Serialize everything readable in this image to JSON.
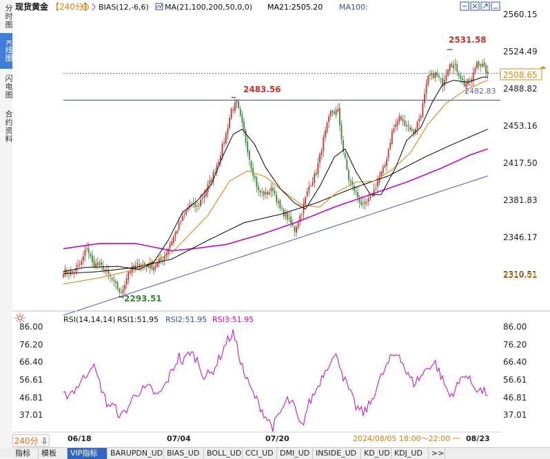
{
  "left_tabs": [
    "分时图",
    "K线图",
    "闪电图",
    "合约资料"
  ],
  "active_left_tab": 1,
  "header": {
    "symbol": "现货黄金",
    "timeframe": "【240分】",
    "bias_label": "BIAS(12,-6,6)",
    "ma_label": "MA(21,100,200,50,0,0)",
    "ma21_label": "MA21:2505.20",
    "ma100_label": "MA100:"
  },
  "price_axis": {
    "ticks": [
      "2560.15",
      "2524.49",
      "2488.82",
      "2453.16",
      "2417.50",
      "2381.83",
      "2346.17",
      "2310.51"
    ],
    "current_price": "2508.65",
    "low_tag": "2317.01"
  },
  "annotations": {
    "high1": "2483.56",
    "high2": "2531.58",
    "low1": "2293.51",
    "hline_label": "2482.83"
  },
  "rsi": {
    "label": "RSI(14,14,14)",
    "rsi1": "RSI1:51.95",
    "rsi2": "RSI2:51.95",
    "rsi3": "RSI3:51.95",
    "ticks": [
      "86.00",
      "76.20",
      "66.40",
      "56.61",
      "46.81",
      "37.01"
    ]
  },
  "date_axis": {
    "dates": [
      "06/18",
      "07/04",
      "07/20"
    ],
    "crosshair_text": "2024/08/05 18:00～22:00 一",
    "last_date": "08/23"
  },
  "bottom_tabs": [
    "指标",
    "模板",
    "VIP指标",
    "BARUPDN_UD",
    "BIAS_UD",
    "BOLL_UD",
    "CCI_UD",
    "DMI_UD",
    "INSIDE_UD",
    "KD_UD",
    "KDJ_UD",
    ">>"
  ],
  "active_bottom_tab": 2,
  "timeframe_corner": "240分",
  "colors": {
    "up": "#c8302a",
    "down": "#2e8b2e",
    "ma21": "#000000",
    "ma100": "#e07b00",
    "ma200": "#000000",
    "ma50": "#cc00cc",
    "rsi": "#cc00cc",
    "trend": "#5050d0",
    "hline": "#3a3ab8",
    "price_tag": "#e08a00"
  },
  "chart_data": {
    "type": "candlestick",
    "title": "现货黄金 【240分】",
    "ylim": [
      2280,
      2566
    ],
    "x_labels": [
      "06/18",
      "07/04",
      "07/20",
      "08/23"
    ],
    "price_ticks": [
      2560.15,
      2524.49,
      2488.82,
      2453.16,
      2417.5,
      2381.83,
      2346.17,
      2310.51
    ],
    "current_price": 2508.65,
    "extremes": {
      "high1": 2483.56,
      "high2": 2531.58,
      "low1": 2293.51
    },
    "horizontal_level": 2482.83,
    "anchors": [
      [
        0,
        2318
      ],
      [
        6,
        2318
      ],
      [
        10,
        2327
      ],
      [
        13,
        2342
      ],
      [
        16,
        2326
      ],
      [
        22,
        2322
      ],
      [
        27,
        2310
      ],
      [
        30,
        2302
      ],
      [
        32,
        2296
      ],
      [
        36,
        2318
      ],
      [
        42,
        2325
      ],
      [
        50,
        2323
      ],
      [
        55,
        2330
      ],
      [
        60,
        2348
      ],
      [
        65,
        2366
      ],
      [
        70,
        2382
      ],
      [
        74,
        2380
      ],
      [
        78,
        2393
      ],
      [
        82,
        2407
      ],
      [
        86,
        2426
      ],
      [
        90,
        2450
      ],
      [
        93,
        2474
      ],
      [
        96,
        2480
      ],
      [
        100,
        2452
      ],
      [
        104,
        2419
      ],
      [
        108,
        2395
      ],
      [
        112,
        2392
      ],
      [
        116,
        2398
      ],
      [
        120,
        2378
      ],
      [
        124,
        2370
      ],
      [
        128,
        2358
      ],
      [
        132,
        2376
      ],
      [
        136,
        2400
      ],
      [
        140,
        2413
      ],
      [
        144,
        2445
      ],
      [
        148,
        2471
      ],
      [
        152,
        2472
      ],
      [
        155,
        2434
      ],
      [
        158,
        2407
      ],
      [
        162,
        2393
      ],
      [
        166,
        2380
      ],
      [
        170,
        2388
      ],
      [
        174,
        2405
      ],
      [
        178,
        2420
      ],
      [
        182,
        2452
      ],
      [
        186,
        2466
      ],
      [
        190,
        2460
      ],
      [
        194,
        2452
      ],
      [
        198,
        2470
      ],
      [
        202,
        2504
      ],
      [
        206,
        2508
      ],
      [
        210,
        2499
      ],
      [
        214,
        2520
      ],
      [
        218,
        2512
      ],
      [
        222,
        2498
      ],
      [
        226,
        2502
      ],
      [
        229,
        2520
      ],
      [
        232,
        2516
      ],
      [
        235,
        2508
      ]
    ],
    "ma21_anchors": [
      [
        0,
        2318
      ],
      [
        12,
        2322
      ],
      [
        30,
        2323
      ],
      [
        42,
        2320
      ],
      [
        50,
        2327
      ],
      [
        58,
        2348
      ],
      [
        66,
        2375
      ],
      [
        74,
        2386
      ],
      [
        82,
        2402
      ],
      [
        88,
        2428
      ],
      [
        94,
        2450
      ],
      [
        99,
        2455
      ],
      [
        106,
        2440
      ],
      [
        112,
        2418
      ],
      [
        120,
        2398
      ],
      [
        128,
        2384
      ],
      [
        134,
        2378
      ],
      [
        142,
        2400
      ],
      [
        150,
        2428
      ],
      [
        156,
        2436
      ],
      [
        162,
        2414
      ],
      [
        170,
        2392
      ],
      [
        176,
        2392
      ],
      [
        184,
        2418
      ],
      [
        190,
        2444
      ],
      [
        198,
        2457
      ],
      [
        204,
        2480
      ],
      [
        210,
        2498
      ],
      [
        216,
        2502
      ],
      [
        224,
        2500
      ],
      [
        232,
        2505
      ],
      [
        235,
        2505
      ]
    ],
    "ma100_anchors": [
      [
        0,
        2306
      ],
      [
        20,
        2312
      ],
      [
        40,
        2320
      ],
      [
        60,
        2336
      ],
      [
        80,
        2372
      ],
      [
        92,
        2405
      ],
      [
        102,
        2415
      ],
      [
        112,
        2409
      ],
      [
        122,
        2395
      ],
      [
        132,
        2382
      ],
      [
        142,
        2380
      ],
      [
        152,
        2395
      ],
      [
        162,
        2404
      ],
      [
        172,
        2405
      ],
      [
        182,
        2416
      ],
      [
        192,
        2432
      ],
      [
        202,
        2460
      ],
      [
        212,
        2480
      ],
      [
        222,
        2492
      ],
      [
        232,
        2500
      ],
      [
        235,
        2502
      ]
    ],
    "ma200_anchors": [
      [
        0,
        2316
      ],
      [
        20,
        2318
      ],
      [
        40,
        2322
      ],
      [
        60,
        2330
      ],
      [
        80,
        2348
      ],
      [
        100,
        2365
      ],
      [
        120,
        2373
      ],
      [
        140,
        2384
      ],
      [
        160,
        2398
      ],
      [
        180,
        2410
      ],
      [
        200,
        2428
      ],
      [
        215,
        2440
      ],
      [
        235,
        2455
      ]
    ],
    "ma50_anchors": [
      [
        0,
        2340
      ],
      [
        20,
        2345
      ],
      [
        40,
        2345
      ],
      [
        60,
        2338
      ],
      [
        72,
        2340
      ],
      [
        90,
        2344
      ],
      [
        110,
        2354
      ],
      [
        130,
        2366
      ],
      [
        150,
        2380
      ],
      [
        170,
        2392
      ],
      [
        190,
        2404
      ],
      [
        210,
        2418
      ],
      [
        225,
        2430
      ],
      [
        235,
        2436
      ]
    ],
    "rsi_anchors": [
      [
        0,
        48
      ],
      [
        6,
        52
      ],
      [
        12,
        60
      ],
      [
        16,
        68
      ],
      [
        20,
        56
      ],
      [
        24,
        44
      ],
      [
        28,
        42
      ],
      [
        32,
        36
      ],
      [
        36,
        42
      ],
      [
        40,
        50
      ],
      [
        44,
        52
      ],
      [
        48,
        53
      ],
      [
        52,
        48
      ],
      [
        56,
        54
      ],
      [
        60,
        63
      ],
      [
        64,
        72
      ],
      [
        66,
        68
      ],
      [
        70,
        75
      ],
      [
        74,
        70
      ],
      [
        78,
        60
      ],
      [
        82,
        62
      ],
      [
        86,
        70
      ],
      [
        90,
        80
      ],
      [
        94,
        86
      ],
      [
        96,
        78
      ],
      [
        100,
        62
      ],
      [
        104,
        52
      ],
      [
        108,
        44
      ],
      [
        112,
        36
      ],
      [
        116,
        30
      ],
      [
        120,
        38
      ],
      [
        124,
        46
      ],
      [
        128,
        42
      ],
      [
        130,
        33
      ],
      [
        132,
        30
      ],
      [
        136,
        44
      ],
      [
        140,
        52
      ],
      [
        144,
        62
      ],
      [
        148,
        70
      ],
      [
        152,
        72
      ],
      [
        155,
        60
      ],
      [
        158,
        52
      ],
      [
        162,
        42
      ],
      [
        166,
        38
      ],
      [
        170,
        44
      ],
      [
        174,
        55
      ],
      [
        178,
        64
      ],
      [
        182,
        72
      ],
      [
        186,
        74
      ],
      [
        190,
        62
      ],
      [
        194,
        56
      ],
      [
        198,
        60
      ],
      [
        202,
        66
      ],
      [
        206,
        68
      ],
      [
        210,
        58
      ],
      [
        214,
        48
      ],
      [
        218,
        54
      ],
      [
        222,
        62
      ],
      [
        226,
        56
      ],
      [
        230,
        52
      ],
      [
        235,
        50
      ]
    ],
    "trend_line": [
      [
        0,
        2276
      ],
      [
        235,
        2410
      ]
    ]
  }
}
